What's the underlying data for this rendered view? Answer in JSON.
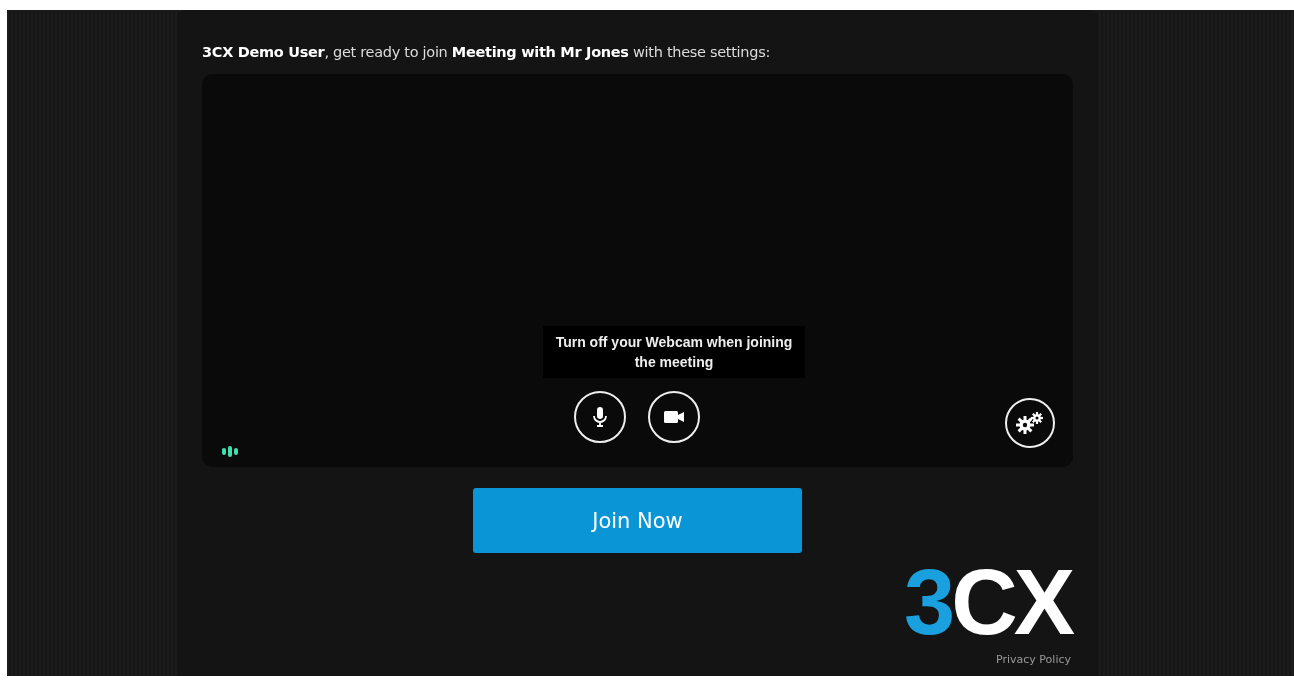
{
  "heading": "**3CX Demo User**, get ready to join **Meeting with Mr Jones** with these settings:",
  "preview": {
    "tooltip": "Turn off your Webcam when joining the meeting",
    "controls": [
      {
        "kind": "microphone",
        "on": true
      },
      {
        "kind": "camera",
        "on": true
      }
    ]
  },
  "join_button": "Join Now",
  "logo": {
    "accent": "3",
    "rest": "CX"
  },
  "privacy_link": "Privacy Policy"
}
